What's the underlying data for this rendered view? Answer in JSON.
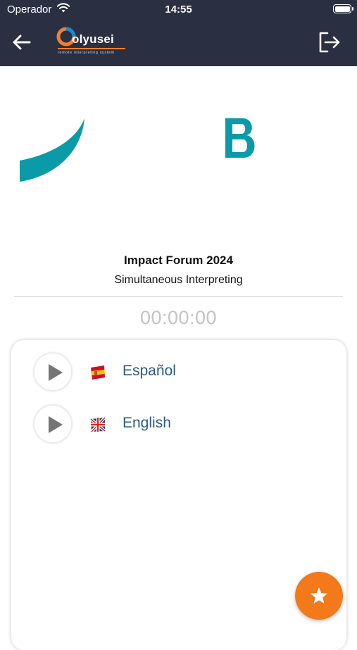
{
  "status_bar": {
    "carrier": "Operador",
    "time": "14:55"
  },
  "header": {
    "brand_name": "olyusei",
    "brand_tagline": "remote interpreting system",
    "back_icon": "arrow-left-icon",
    "logout_icon": "logout-icon"
  },
  "event": {
    "title": "Impact Forum 2024",
    "subtitle": "Simultaneous Interpreting",
    "timer": "00:00:00"
  },
  "languages": [
    {
      "label": "Español",
      "flag_icon": "spain-flag-icon",
      "play_icon": "play-icon"
    },
    {
      "label": "English",
      "flag_icon": "uk-flag-icon",
      "play_icon": "play-icon"
    }
  ],
  "fab": {
    "icon": "star-icon"
  },
  "colors": {
    "header_bg": "#2b2f42",
    "accent_orange": "#f27a1a",
    "language_text": "#2b5b86",
    "timer_text": "#c4c4c4",
    "logo_teal": "#0a9aa8"
  }
}
